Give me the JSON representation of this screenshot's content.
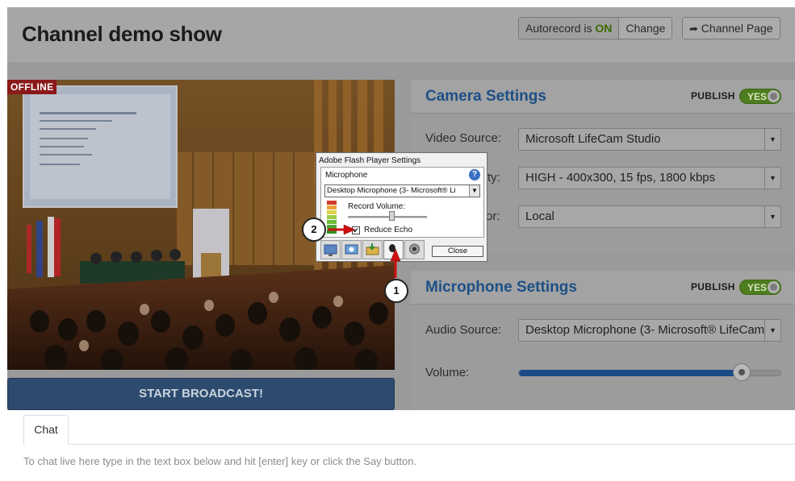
{
  "header": {
    "title": "Channel demo show",
    "autorecord_label": "Autorecord is",
    "autorecord_state": "ON",
    "change_label": "Change",
    "channel_page_label": "Channel Page"
  },
  "video": {
    "status_badge": "OFFLINE",
    "start_broadcast_label": "START BROADCAST!"
  },
  "camera_settings": {
    "title": "Camera Settings",
    "publish_label": "PUBLISH",
    "toggle_label": "YES",
    "video_source_label": "Video Source:",
    "video_source_value": "Microsoft LifeCam Studio",
    "quality_label_visible": "ty:",
    "quality_value": "HIGH - 400x300, 15 fps, 1800 kbps",
    "third_label_visible": "or:",
    "third_value": "Local"
  },
  "microphone_settings": {
    "title": "Microphone Settings",
    "publish_label": "PUBLISH",
    "toggle_label": "YES",
    "audio_source_label": "Audio Source:",
    "audio_source_value": "Desktop Microphone (3- Microsoft® LifeCam",
    "volume_label": "Volume:",
    "volume_level": 0.85
  },
  "flash_dialog": {
    "title": "Adobe Flash Player Settings",
    "section": "Microphone",
    "help": "?",
    "device": "Desktop Microphone (3- Microsoft® Li",
    "record_volume_label": "Record Volume:",
    "record_volume_level": 0.55,
    "reduce_echo_label": "Reduce Echo",
    "reduce_echo_checked": "✔",
    "close_label": "Close"
  },
  "callouts": {
    "one": "1",
    "two": "2"
  },
  "chat": {
    "tab_label": "Chat",
    "hint": "To chat live here type in the text box below and hit [enter] key or click the Say button."
  },
  "colors": {
    "accent_blue": "#1d4f86",
    "toggle_green": "#4d7d1e",
    "offline_red": "#8a1a1a",
    "callout_arrow_red": "#d01010"
  }
}
